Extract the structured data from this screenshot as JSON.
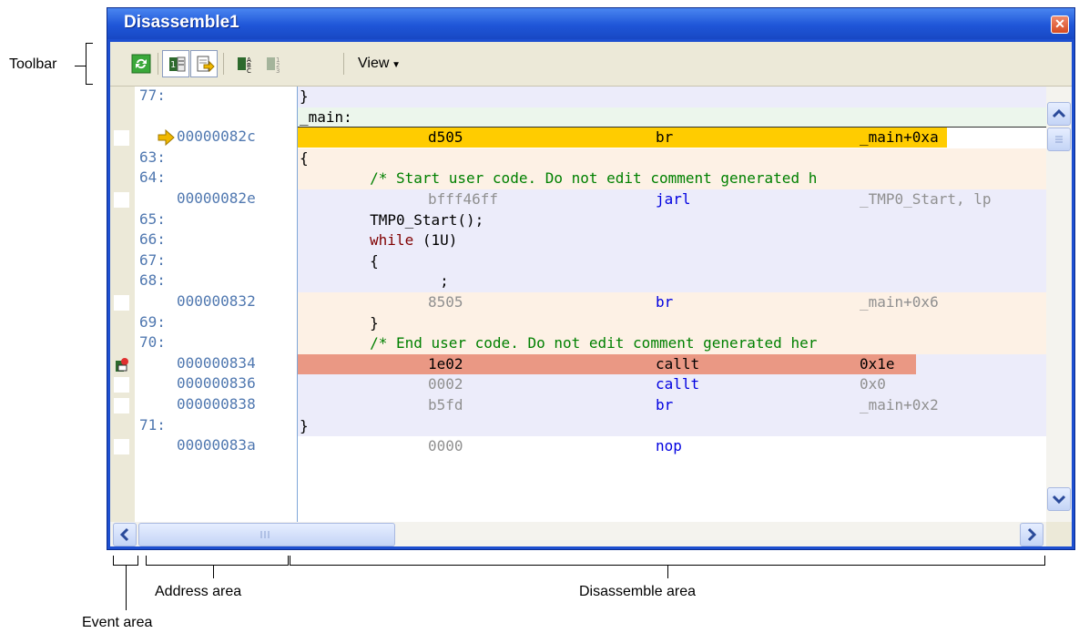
{
  "window": {
    "title": "Disassemble1"
  },
  "toolbar": {
    "view_label": "View"
  },
  "annotations": {
    "toolbar": "Toolbar",
    "address_area": "Address area",
    "disassemble_area": "Disassemble area",
    "event_area": "Event area"
  },
  "rows": [
    {
      "kind": "src",
      "bg": "lav",
      "line": "77:",
      "src": "}"
    },
    {
      "kind": "label",
      "bg": "green",
      "label": "_main:"
    },
    {
      "kind": "asm",
      "bg": "white",
      "addr": "00000082c",
      "code": "d505",
      "mnemonic": "br",
      "operand": "_main+0xa",
      "highlight": "current-pc"
    },
    {
      "kind": "src",
      "bg": "peach",
      "line": "63:",
      "src": "{"
    },
    {
      "kind": "src",
      "bg": "peach",
      "line": "64:",
      "src": "        /* Start user code. Do not edit comment generated h"
    },
    {
      "kind": "asm",
      "bg": "lav",
      "addr": "00000082e",
      "code": "bfff46ff",
      "mnemonic": "jarl",
      "operand": "_TMP0_Start, lp"
    },
    {
      "kind": "src",
      "bg": "lav",
      "line": "65:",
      "src": "        TMP0_Start();"
    },
    {
      "kind": "src",
      "bg": "lav",
      "line": "66:",
      "src_kw": "while",
      "src_rest": " (1U)"
    },
    {
      "kind": "src",
      "bg": "lav",
      "line": "67:",
      "src": "        {"
    },
    {
      "kind": "src",
      "bg": "lav",
      "line": "68:",
      "src": "                ;"
    },
    {
      "kind": "asm",
      "bg": "peach",
      "addr": "000000832",
      "code": "8505",
      "mnemonic": "br",
      "operand": "_main+0x6"
    },
    {
      "kind": "src",
      "bg": "peach",
      "line": "69:",
      "src": "        }"
    },
    {
      "kind": "src",
      "bg": "peach",
      "line": "70:",
      "src": "        /* End user code. Do not edit comment generated her"
    },
    {
      "kind": "asm",
      "bg": "lav",
      "addr": "000000834",
      "code": "1e02",
      "mnemonic": "callt",
      "operand": "0x1e",
      "highlight": "breakpoint"
    },
    {
      "kind": "asm",
      "bg": "lav",
      "addr": "000000836",
      "code": "0002",
      "mnemonic": "callt",
      "operand": "0x0"
    },
    {
      "kind": "asm",
      "bg": "lav",
      "addr": "000000838",
      "code": "b5fd",
      "mnemonic": "br",
      "operand": "_main+0x2"
    },
    {
      "kind": "src",
      "bg": "lav",
      "line": "71:",
      "src": "}"
    },
    {
      "kind": "asm",
      "bg": "white",
      "addr": "00000083a",
      "code": "0000",
      "mnemonic": "nop",
      "operand": ""
    }
  ],
  "colors": {
    "title_bar": "#1f56d8",
    "pc_highlight": "#ffcc00",
    "breakpoint_highlight": "#ea9884",
    "address_text": "#5078b0",
    "mnemonic": "#0000e0",
    "comment": "#008000"
  },
  "icons": [
    "refresh-icon",
    "mixed-display-icon",
    "go-to-icon",
    "symbol-display-icon",
    "symbol-offset-icon",
    "current-pc-arrow-icon",
    "breakpoint-event-icon"
  ]
}
